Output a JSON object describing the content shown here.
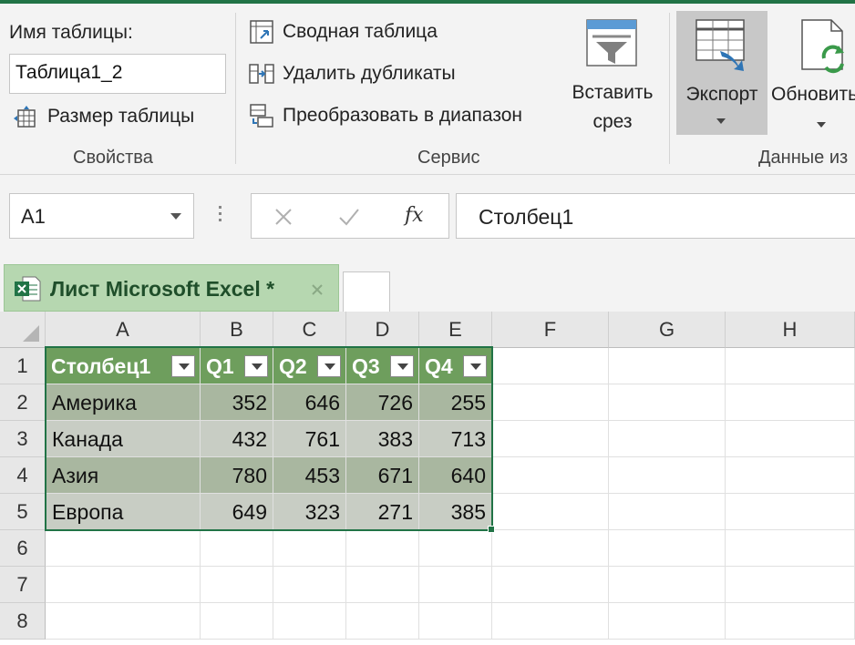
{
  "ribbon": {
    "table_name_label": "Имя таблицы:",
    "table_name_value": "Таблица1_2",
    "resize_table": "Размер таблицы",
    "group_properties": "Свойства",
    "pivot_table": "Сводная таблица",
    "remove_duplicates": "Удалить дубликаты",
    "convert_to_range": "Преобразовать в диапазон",
    "group_tools": "Сервис",
    "insert_slicer_line1": "Вставить",
    "insert_slicer_line2": "срез",
    "export_label": "Экспорт",
    "refresh_label": "Обновить",
    "group_external_data": "Данные из"
  },
  "formula_bar": {
    "cell_ref": "A1",
    "fx": "fx",
    "content": "Столбец1"
  },
  "sheet_tab": {
    "label": "Лист Microsoft Excel *"
  },
  "grid": {
    "columns": [
      "A",
      "B",
      "C",
      "D",
      "E",
      "F",
      "G",
      "H"
    ],
    "rows": [
      "1",
      "2",
      "3",
      "4",
      "5",
      "6",
      "7",
      "8"
    ],
    "table_headers": [
      "Столбец1",
      "Q1",
      "Q2",
      "Q3",
      "Q4"
    ],
    "table_rows": [
      {
        "name": "Америка",
        "q1": "352",
        "q2": "646",
        "q3": "726",
        "q4": "255"
      },
      {
        "name": "Канада",
        "q1": "432",
        "q2": "761",
        "q3": "383",
        "q4": "713"
      },
      {
        "name": "Азия",
        "q1": "780",
        "q2": "453",
        "q3": "671",
        "q4": "640"
      },
      {
        "name": "Европа",
        "q1": "649",
        "q2": "323",
        "q3": "271",
        "q4": "385"
      }
    ]
  },
  "colors": {
    "accent": "#217346",
    "table_header": "#6e9e5d",
    "band_dark": "#a9b7a0",
    "band_light": "#c8cdc4",
    "sheet_tab": "#b6d7b0"
  }
}
